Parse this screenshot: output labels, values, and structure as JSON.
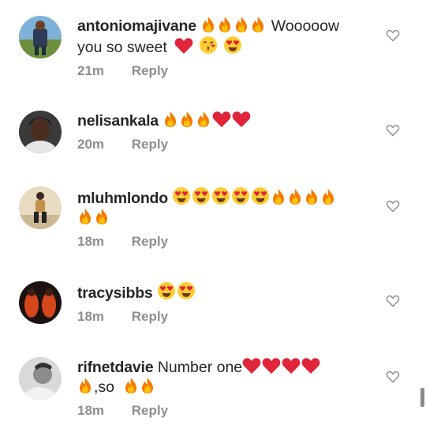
{
  "comments": [
    {
      "username": "antoniomajivane",
      "text_line1": "Wooooow",
      "text_line2": "you so sweet",
      "emoji_line1": [
        "fire-icon",
        "fire-icon",
        "fire-icon",
        "fire-icon"
      ],
      "emoji_line2": [
        "red-heart-icon",
        "kissing-face-icon",
        "heart-eyes-icon"
      ],
      "time": "21m",
      "reply_label": "Reply"
    },
    {
      "username": "nelisankala",
      "emoji_line1": [
        "fire-icon",
        "fire-icon",
        "fire-icon",
        "red-heart-icon",
        "red-heart-icon"
      ],
      "time": "20m",
      "reply_label": "Reply"
    },
    {
      "username": "mluhmlondo",
      "emoji_line1": [
        "heart-eyes-icon",
        "heart-eyes-icon",
        "heart-eyes-icon",
        "heart-eyes-icon",
        "heart-eyes-icon",
        "fire-icon",
        "fire-icon",
        "fire-icon",
        "fire-icon"
      ],
      "emoji_line2": [
        "fire-icon",
        "fire-icon"
      ],
      "time": "18m",
      "reply_label": "Reply"
    },
    {
      "username": "tracysibbs",
      "emoji_line1": [
        "heart-eyes-icon",
        "heart-eyes-icon"
      ],
      "time": "18m",
      "reply_label": "Reply"
    },
    {
      "username": "rifnetdavie",
      "text_line1": "Number one",
      "emoji_line1_after": [
        "red-heart-icon",
        "red-heart-icon",
        "red-heart-icon",
        "red-heart-icon"
      ],
      "text_line2": ",so",
      "time": "18m",
      "reply_label": "Reply"
    }
  ],
  "colors": {
    "text": "#262626",
    "meta": "#8e8e8e",
    "heart_outline": "#8e8e8e",
    "fire": "#f57c00",
    "red_heart": "#e0243a",
    "emoji_face": "#ffcc33"
  }
}
